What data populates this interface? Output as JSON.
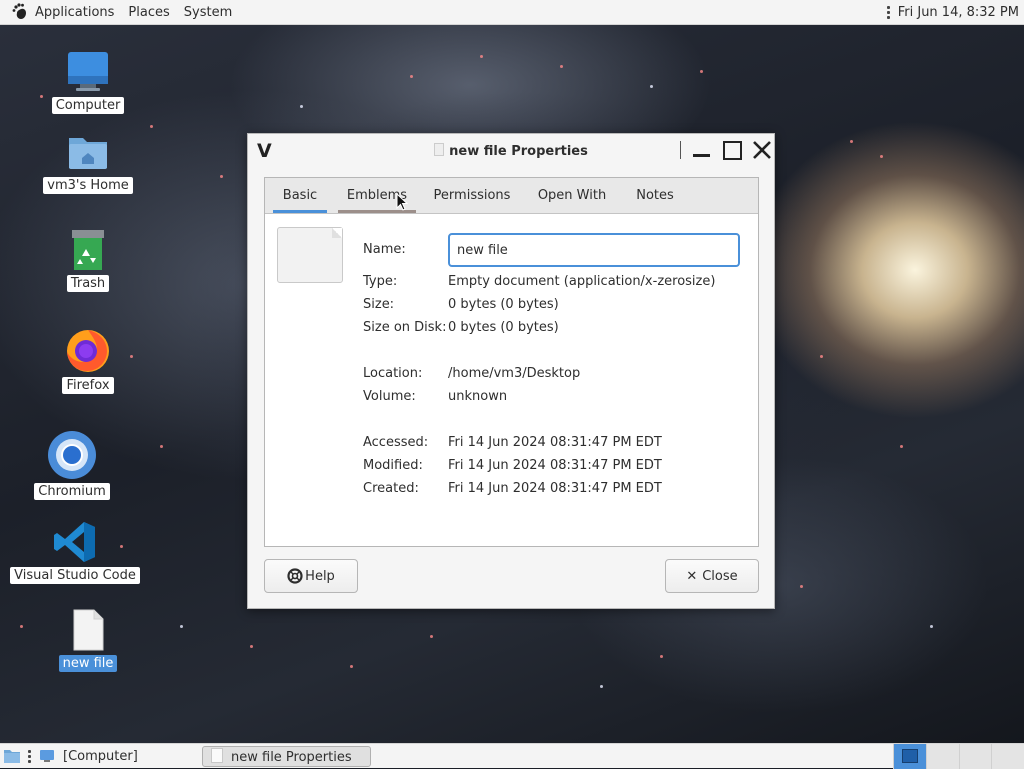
{
  "top_panel": {
    "menus": [
      "Applications",
      "Places",
      "System"
    ],
    "clock": "Fri Jun 14,  8:32 PM"
  },
  "desktop_icons": [
    {
      "label": "Computer",
      "icon": "computer-icon"
    },
    {
      "label": "vm3's Home",
      "icon": "home-folder-icon"
    },
    {
      "label": "Trash",
      "icon": "trash-icon"
    },
    {
      "label": "Firefox",
      "icon": "firefox-icon"
    },
    {
      "label": "Chromium",
      "icon": "chromium-icon"
    },
    {
      "label": "Visual Studio Code",
      "icon": "vscode-icon"
    },
    {
      "label": "new file",
      "icon": "document-icon",
      "selected": true
    }
  ],
  "dialog": {
    "title": "new file Properties",
    "tabs": [
      "Basic",
      "Emblems",
      "Permissions",
      "Open With",
      "Notes"
    ],
    "active_tab": "Basic",
    "fields": {
      "name_label": "Name:",
      "name_value": "new file",
      "type_label": "Type:",
      "type_value": "Empty document (application/x-zerosize)",
      "size_label": "Size:",
      "size_value": "0 bytes (0 bytes)",
      "disk_label": "Size on Disk:",
      "disk_value": "0 bytes (0 bytes)",
      "location_label": "Location:",
      "location_value": "/home/vm3/Desktop",
      "volume_label": "Volume:",
      "volume_value": "unknown",
      "accessed_label": "Accessed:",
      "accessed_value": "Fri 14 Jun 2024 08:31:47 PM EDT",
      "modified_label": "Modified:",
      "modified_value": "Fri 14 Jun 2024 08:31:47 PM EDT",
      "created_label": "Created:",
      "created_value": "Fri 14 Jun 2024 08:31:47 PM EDT"
    },
    "help_label": "Help",
    "close_label": "Close"
  },
  "taskbar": {
    "tasks": [
      "[Computer]",
      "new file Properties"
    ],
    "active_task": "new file Properties"
  },
  "colors": {
    "accent": "#4a90d9",
    "panel": "#f4f4f4"
  }
}
